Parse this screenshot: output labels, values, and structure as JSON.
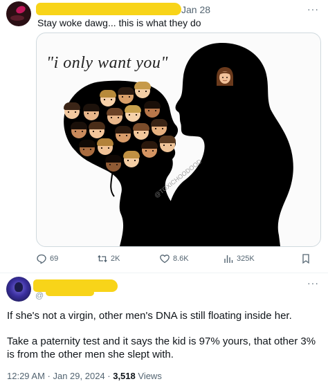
{
  "tweet1": {
    "date": "Jan 28",
    "more_icon": "···",
    "text": "Stay woke dawg... this is what they do",
    "image": {
      "quote": "\"i only want you\"",
      "watermark": "@TOXICHOODOOD"
    },
    "actions": {
      "replies": "69",
      "retweets": "2K",
      "likes": "8.6K",
      "views": "325K"
    }
  },
  "tweet2": {
    "handle": "@",
    "more_icon": "···",
    "body": [
      "If she's not a virgin, other men's DNA is still floating inside her.",
      "Take a paternity test and it says the kid is 97% yours, that other 3% is from the other men she slept with."
    ],
    "timestamp": "12:29 AM · Jan 29, 2024 · ",
    "views_count": "3,518",
    "views_label": " Views"
  },
  "colors": {
    "redaction": "#f8d419",
    "muted": "#536471",
    "text": "#0f1419",
    "silhouette": "#000000"
  }
}
